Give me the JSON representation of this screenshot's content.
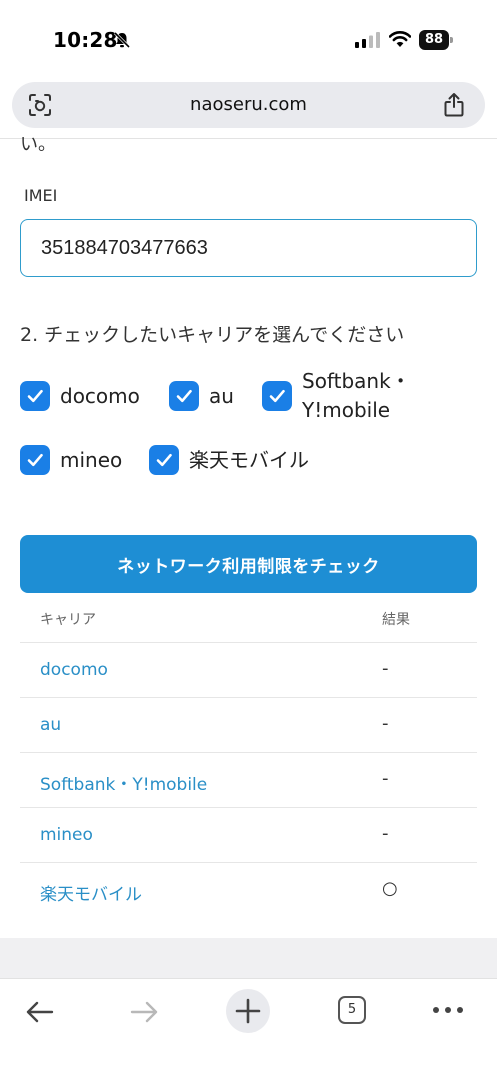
{
  "status_bar": {
    "time": "10:28",
    "battery": "88"
  },
  "browser": {
    "url": "naoseru.com",
    "tab_count": "5"
  },
  "form": {
    "partial_text": "い。",
    "imei_label": "IMEI",
    "imei_value": "351884703477663",
    "carrier_heading": "2. チェックしたいキャリアを選んでください",
    "carriers": [
      {
        "label": "docomo",
        "checked": true
      },
      {
        "label": "au",
        "checked": true
      },
      {
        "label_line1": "Softbank・",
        "label_line2": "Y!mobile",
        "checked": true
      },
      {
        "label": "mineo",
        "checked": true
      },
      {
        "label": "楽天モバイル",
        "checked": true
      }
    ],
    "check_button_label": "ネットワーク利用制限をチェック"
  },
  "results_table": {
    "headers": [
      "キャリア",
      "結果"
    ],
    "rows": [
      {
        "carrier": "docomo",
        "result": "-"
      },
      {
        "carrier": "au",
        "result": "-"
      },
      {
        "carrier": "Softbank・Y!mobile",
        "result": "-"
      },
      {
        "carrier": "mineo",
        "result": "-"
      },
      {
        "carrier": "楽天モバイル",
        "result": "○"
      }
    ]
  },
  "colors": {
    "accent_blue": "#1e8ed4",
    "checkbox_blue": "#1a7fe6",
    "link_blue": "#2a8fc7"
  }
}
